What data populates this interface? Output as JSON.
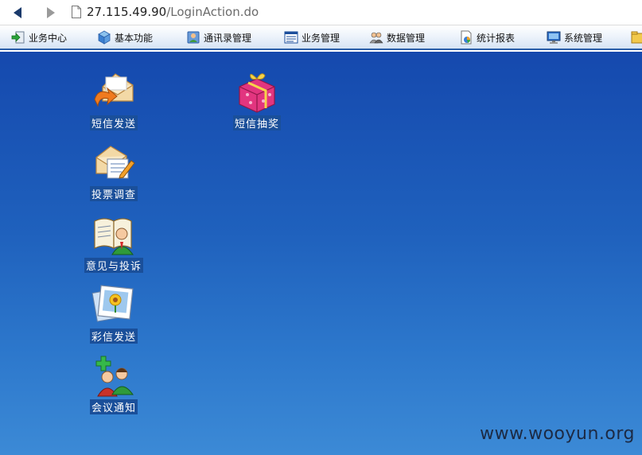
{
  "browser": {
    "url_host": "27.115.49.90",
    "url_path": "/LoginAction.do",
    "back_icon": "back-arrow-icon",
    "forward_icon": "forward-arrow-icon"
  },
  "menubar": {
    "items": [
      {
        "label": "业务中心",
        "icon": "enter-icon"
      },
      {
        "label": "基本功能",
        "icon": "cube-icon"
      },
      {
        "label": "通讯录管理",
        "icon": "contacts-icon"
      },
      {
        "label": "业务管理",
        "icon": "window-icon"
      },
      {
        "label": "数据管理",
        "icon": "people-icon"
      },
      {
        "label": "统计报表",
        "icon": "report-icon"
      },
      {
        "label": "系统管理",
        "icon": "monitor-icon"
      }
    ]
  },
  "desktop": {
    "icons": [
      {
        "label": "短信发送",
        "icon": "envelope-send-icon"
      },
      {
        "label": "短信抽奖",
        "icon": "gift-box-icon"
      },
      {
        "label": "投票调查",
        "icon": "envelope-pencil-icon"
      },
      {
        "label": "意见与投诉",
        "icon": "book-person-icon"
      },
      {
        "label": "彩信发送",
        "icon": "picture-flower-icon"
      },
      {
        "label": "会议通知",
        "icon": "meeting-people-icon"
      }
    ]
  },
  "watermark": "www.wooyun.org",
  "colors": {
    "desktop_top": "#1549ae",
    "desktop_bottom": "#3c8ad6",
    "menubar_border": "#2b5fa8"
  }
}
